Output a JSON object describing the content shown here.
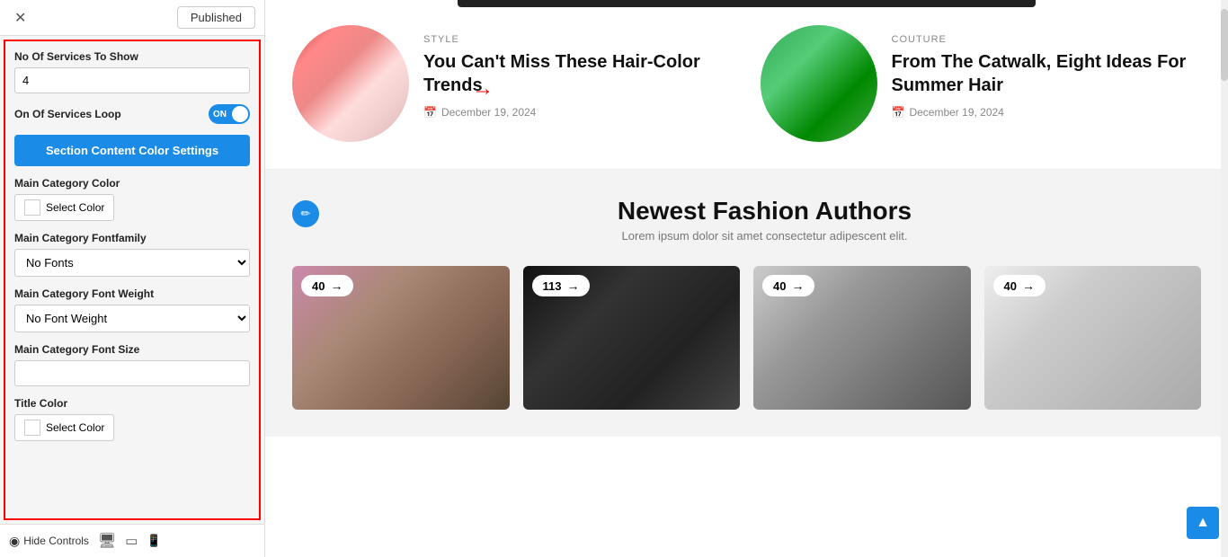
{
  "topBar": {
    "closeLabel": "✕",
    "publishedLabel": "Published"
  },
  "panel": {
    "noOfServicesLabel": "No Of Services To Show",
    "noOfServicesValue": "4",
    "onOfServicesLoopLabel": "On Of Services Loop",
    "toggleText": "ON",
    "sectionContentBtnLabel": "Section Content Color Settings",
    "mainCategoryColorLabel": "Main Category Color",
    "selectColorLabel1": "Select Color",
    "mainCategoryFontfamilyLabel": "Main Category Fontfamily",
    "noFontsOption": "No Fonts",
    "mainCategoryFontWeightLabel": "Main Category Font Weight",
    "noFontWeightOption": "No Font Weight",
    "mainCategoryFontSizeLabel": "Main Category Font Size",
    "fontSizeValue": "",
    "titleColorLabel": "Title Color",
    "selectColorLabel2": "Select Color"
  },
  "bottomBar": {
    "hideControlsLabel": "Hide Controls"
  },
  "mainContent": {
    "articles": [
      {
        "category": "STYLE",
        "title": "You Can't Miss These Hair-Color Trends",
        "date": "December 19, 2024"
      },
      {
        "category": "COUTURE",
        "title": "From The Catwalk, Eight Ideas For Summer Hair",
        "date": "December 19, 2024"
      }
    ],
    "authorsSection": {
      "title": "Newest Fashion Authors",
      "subtitle": "Lorem ipsum dolor sit amet consectetur adipescent elit.",
      "authors": [
        {
          "count": "40",
          "id": 1
        },
        {
          "count": "113",
          "id": 2
        },
        {
          "count": "40",
          "id": 3
        },
        {
          "count": "40",
          "id": 4
        }
      ]
    }
  },
  "icons": {
    "close": "✕",
    "edit": "✏",
    "calendar": "📅",
    "desktop": "🖥",
    "tablet": "⬜",
    "mobile": "📱",
    "arrowUp": "▲",
    "arrowRight": "→",
    "chevronDown": "▾",
    "circleArrowUp": "↑"
  }
}
